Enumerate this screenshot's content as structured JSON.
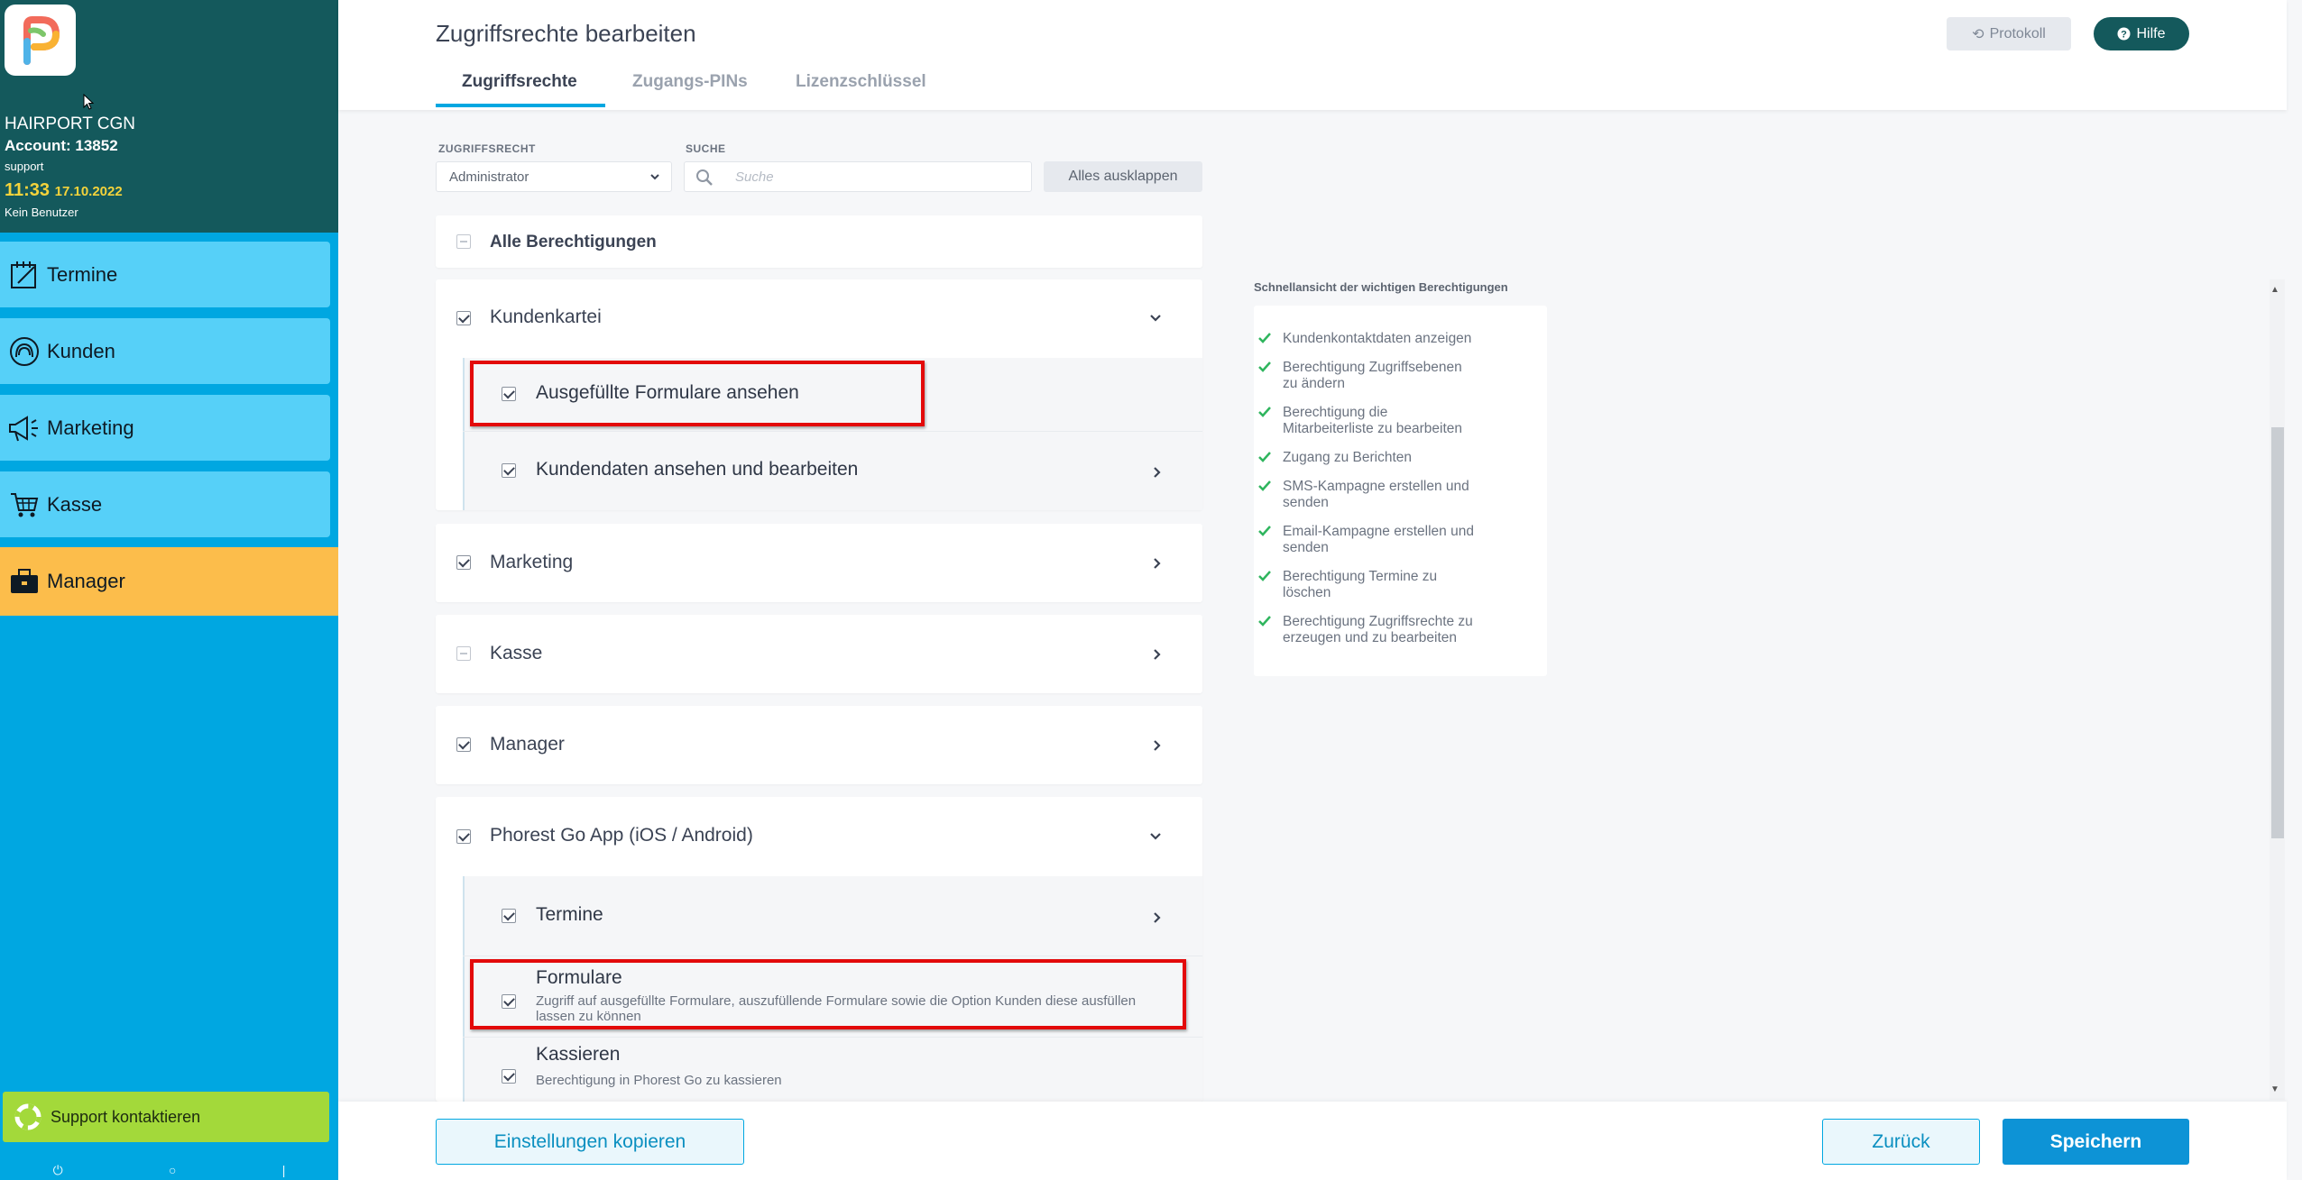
{
  "sidebar": {
    "salon_name": "HAIRPORT CGN",
    "account": "Account: 13852",
    "user_role": "support",
    "time": "11:33",
    "date": "17.10.2022",
    "no_user": "Kein Benutzer",
    "nav": [
      {
        "label": "Termine",
        "icon": "calendar-pen-icon"
      },
      {
        "label": "Kunden",
        "icon": "customer-icon"
      },
      {
        "label": "Marketing",
        "icon": "megaphone-icon"
      },
      {
        "label": "Kasse",
        "icon": "cart-icon"
      },
      {
        "label": "Manager",
        "icon": "briefcase-icon"
      }
    ],
    "support_label": "Support kontaktieren",
    "colors": {
      "header": "#14595c",
      "nav": "#56d0f8",
      "active": "#fcbd4b",
      "support": "#a3d93a"
    }
  },
  "header": {
    "title": "Zugriffsrechte bearbeiten",
    "protokoll_label": "Protokoll",
    "hilfe_label": "Hilfe",
    "tabs": [
      {
        "label": "Zugriffsrechte",
        "active": true
      },
      {
        "label": "Zugangs-PINs",
        "active": false
      },
      {
        "label": "Lizenzschlüssel",
        "active": false
      }
    ]
  },
  "filters": {
    "role_label": "ZUGRIFFSRECHT",
    "role_value": "Administrator",
    "search_label": "SUCHE",
    "search_placeholder": "Suche",
    "expand_label": "Alles ausklappen"
  },
  "permissions": {
    "all": {
      "label": "Alle Berechtigungen",
      "state": "partial"
    },
    "groups": [
      {
        "label": "Kundenkartei",
        "state": "checked",
        "expanded": true,
        "children": [
          {
            "label": "Ausgefüllte Formulare ansehen",
            "state": "checked",
            "highlighted": true
          },
          {
            "label": "Kundendaten ansehen und bearbeiten",
            "state": "checked",
            "has_children": true
          }
        ]
      },
      {
        "label": "Marketing",
        "state": "checked",
        "expanded": false
      },
      {
        "label": "Kasse",
        "state": "partial",
        "expanded": false
      },
      {
        "label": "Manager",
        "state": "checked",
        "expanded": false
      },
      {
        "label": "Phorest Go App (iOS / Android)",
        "state": "checked",
        "expanded": true,
        "children": [
          {
            "label": "Termine",
            "state": "checked",
            "has_children": true
          },
          {
            "label": "Formulare",
            "state": "checked",
            "highlighted": true,
            "description": "Zugriff auf ausgefüllte Formulare, auszufüllende Formulare sowie die Option Kunden diese ausfüllen lassen zu können"
          },
          {
            "label": "Kassieren",
            "state": "checked",
            "description": "Berechtigung in Phorest Go zu kassieren"
          }
        ]
      }
    ]
  },
  "quickview": {
    "title": "Schnellansicht der wichtigen Berechtigungen",
    "items": [
      {
        "line1": "Kundenkontaktdaten anzeigen",
        "line2": ""
      },
      {
        "line1": "Berechtigung Zugriffsebenen",
        "line2": "zu ändern"
      },
      {
        "line1": "Berechtigung die",
        "line2": "Mitarbeiterliste zu bearbeiten"
      },
      {
        "line1": "Zugang zu Berichten",
        "line2": ""
      },
      {
        "line1": "SMS-Kampagne erstellen und",
        "line2": "senden"
      },
      {
        "line1": "Email-Kampagne erstellen und",
        "line2": "senden"
      },
      {
        "line1": "Berechtigung Termine zu",
        "line2": "löschen"
      },
      {
        "line1": "Berechtigung Zugriffsrechte zu",
        "line2": "erzeugen und zu bearbeiten"
      }
    ],
    "check_color": "#2fb55e"
  },
  "footer": {
    "copy_label": "Einstellungen kopieren",
    "back_label": "Zurück",
    "save_label": "Speichern"
  },
  "accent_color": "#00a7e1",
  "highlight_color": "#e30a0a"
}
